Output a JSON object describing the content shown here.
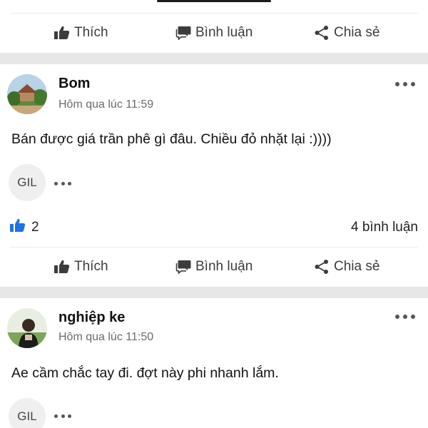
{
  "actions": {
    "like": "Thích",
    "comment": "Bình luận",
    "share": "Chia sẻ"
  },
  "posts": [
    {
      "author": "Bom",
      "time": "Hôm qua lúc 11:59",
      "body": "Bán được giá trần phê gì đâu. Chiều đỏ nhặt lại :))))",
      "reaction_chip": "GIL",
      "like_count": "2",
      "comment_count": "4 bình luận"
    },
    {
      "author": "nghiệp ke",
      "time": "Hôm qua lúc 11:50",
      "body": "Ae cầm chắc tay đi. đợt này phi nhanh lắm.",
      "reaction_chip": "GIL"
    }
  ],
  "colors": {
    "accent_like": "#1a73e8",
    "separator": "#e7e7e8",
    "text_secondary": "#6b6b6b"
  },
  "icons": {
    "like": "thumbs-up-icon",
    "comment": "speech-bubble-icon",
    "share": "share-icon",
    "more": "more-dots-icon"
  }
}
